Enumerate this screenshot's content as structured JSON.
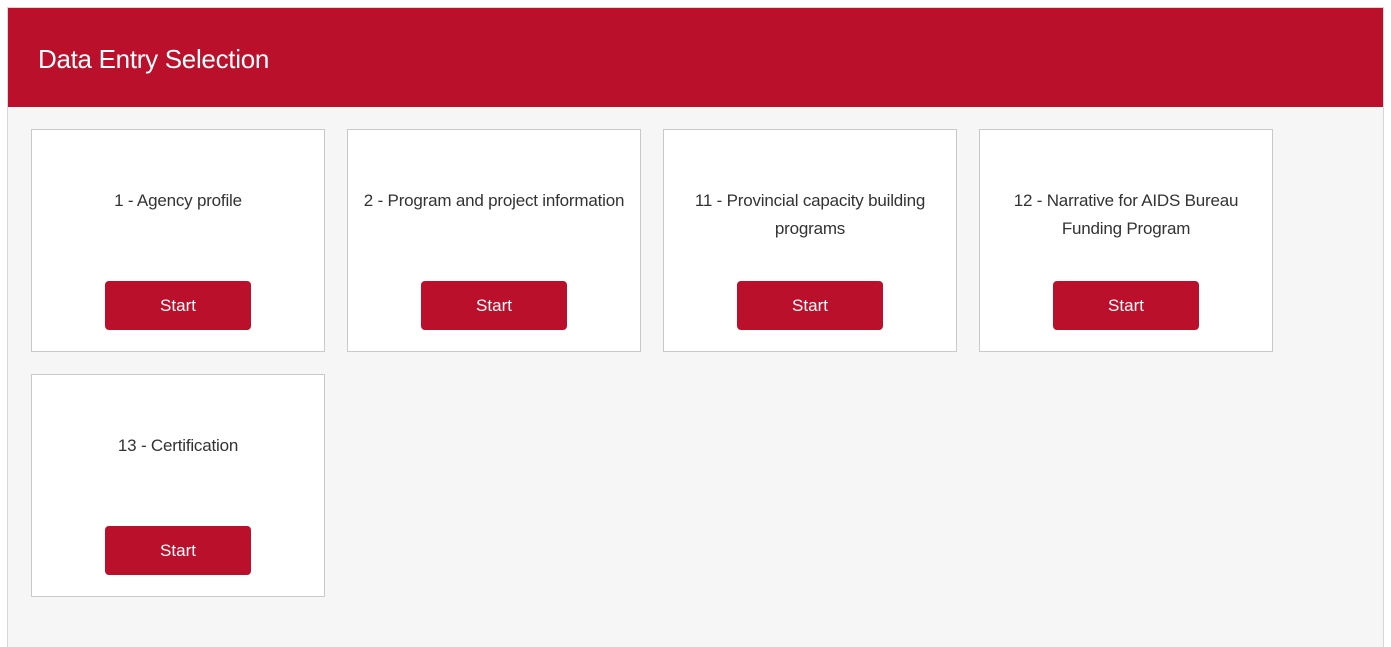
{
  "panel": {
    "title": "Data Entry Selection"
  },
  "cards": [
    {
      "label": "1 - Agency profile",
      "button": "Start"
    },
    {
      "label": "2 - Program and project information",
      "button": "Start"
    },
    {
      "label": "11 - Provincial capacity building programs",
      "button": "Start"
    },
    {
      "label": "12 - Narrative for AIDS Bureau Funding Program",
      "button": "Start"
    },
    {
      "label": "13 - Certification",
      "button": "Start"
    }
  ],
  "colors": {
    "accent": "#bb102c",
    "panel_background": "#f6f6f6"
  }
}
